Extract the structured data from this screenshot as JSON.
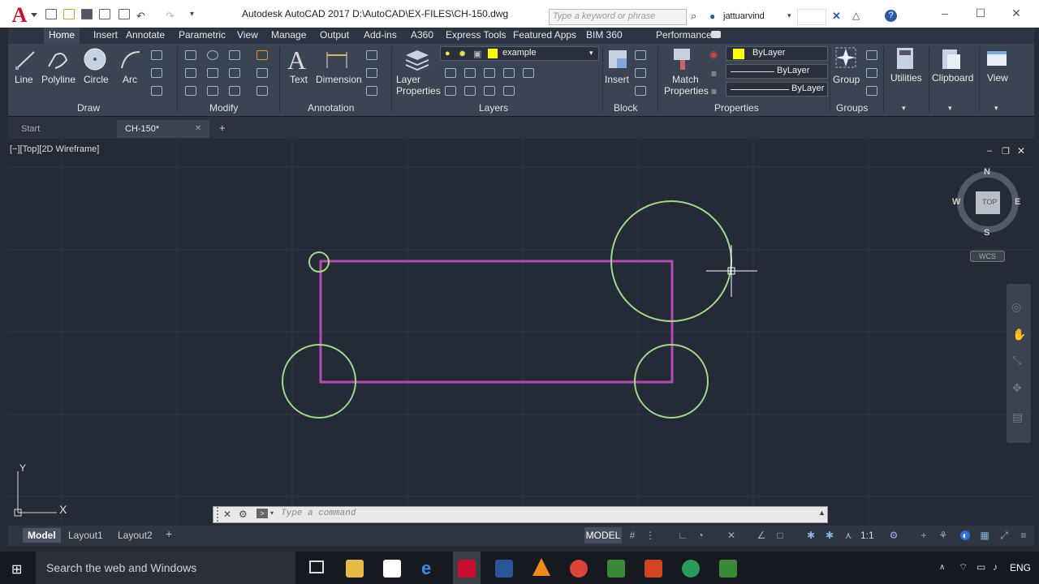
{
  "window": {
    "title": "Autodesk AutoCAD 2017     D:\\AutoCAD\\EX-FILES\\CH-150.dwg",
    "search_placeholder": "Type a keyword or phrase",
    "user": "jattuarvind"
  },
  "app_logo": "A",
  "ribbon_tabs": [
    "Home",
    "Insert",
    "Annotate",
    "Parametric",
    "View",
    "Manage",
    "Output",
    "Add-ins",
    "A360",
    "Express Tools",
    "Featured Apps",
    "BIM 360",
    "Performance"
  ],
  "ribbon": {
    "draw": {
      "line": "Line",
      "polyline": "Polyline",
      "circle": "Circle",
      "arc": "Arc",
      "panel": "Draw"
    },
    "modify": {
      "panel": "Modify"
    },
    "annotation": {
      "text": "Text",
      "dimension": "Dimension",
      "panel": "Annotation"
    },
    "layers": {
      "layer_properties_1": "Layer",
      "layer_properties_2": "Properties",
      "current_layer": "example",
      "panel": "Layers"
    },
    "block": {
      "insert": "Insert",
      "panel": "Block"
    },
    "properties": {
      "match_1": "Match",
      "match_2": "Properties",
      "color": "ByLayer",
      "linetype": "ByLayer",
      "lineweight": "ByLayer",
      "panel": "Properties"
    },
    "groups": {
      "group": "Group",
      "panel": "Groups"
    },
    "utilities": "Utilities",
    "clipboard": "Clipboard",
    "view": "View"
  },
  "file_tabs": {
    "start": "Start",
    "active": "CH-150*"
  },
  "viewport": {
    "label": "[−][Top][2D Wireframe]"
  },
  "viewcube": {
    "n": "N",
    "s": "S",
    "e": "E",
    "w": "W",
    "face": "TOP",
    "wcs": "WCS"
  },
  "ucs": {
    "x": "X",
    "y": "Y"
  },
  "command": {
    "placeholder": "Type a command"
  },
  "layout_tabs": {
    "model": "Model",
    "layout1": "Layout1",
    "layout2": "Layout2"
  },
  "status": {
    "model": "MODEL",
    "scale": "1:1"
  },
  "taskbar": {
    "search": "Search the web and Windows",
    "lang": "ENG"
  },
  "colors": {
    "rectangle": "#b04bb0",
    "circles": "#9fd88a",
    "layer_color": "#ffff00",
    "canvas": "#252b36"
  }
}
